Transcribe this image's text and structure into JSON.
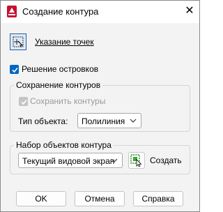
{
  "window": {
    "title": "Создание контура"
  },
  "pick": {
    "label": "Указание точек"
  },
  "island": {
    "label": "Решение островков",
    "checked": true
  },
  "retain": {
    "group_title": "Сохранение контуров",
    "checkbox_label": "Сохранить контуры",
    "object_type_label": "Тип объекта:",
    "object_type_value": "Полилиния"
  },
  "boundary_set": {
    "group_title": "Набор объектов контура",
    "value": "Текущий видовой экран",
    "new_label": "Создать"
  },
  "buttons": {
    "ok": "OK",
    "cancel": "Отмена",
    "help": "Справка"
  },
  "colors": {
    "accent": "#0067c0",
    "app_icon": "#c8102e",
    "pick_button_border": "#1f5fa8"
  },
  "icons": {
    "app": "autocad-icon",
    "pick": "pick-points-icon",
    "select": "select-objects-icon",
    "close": "close-icon"
  }
}
